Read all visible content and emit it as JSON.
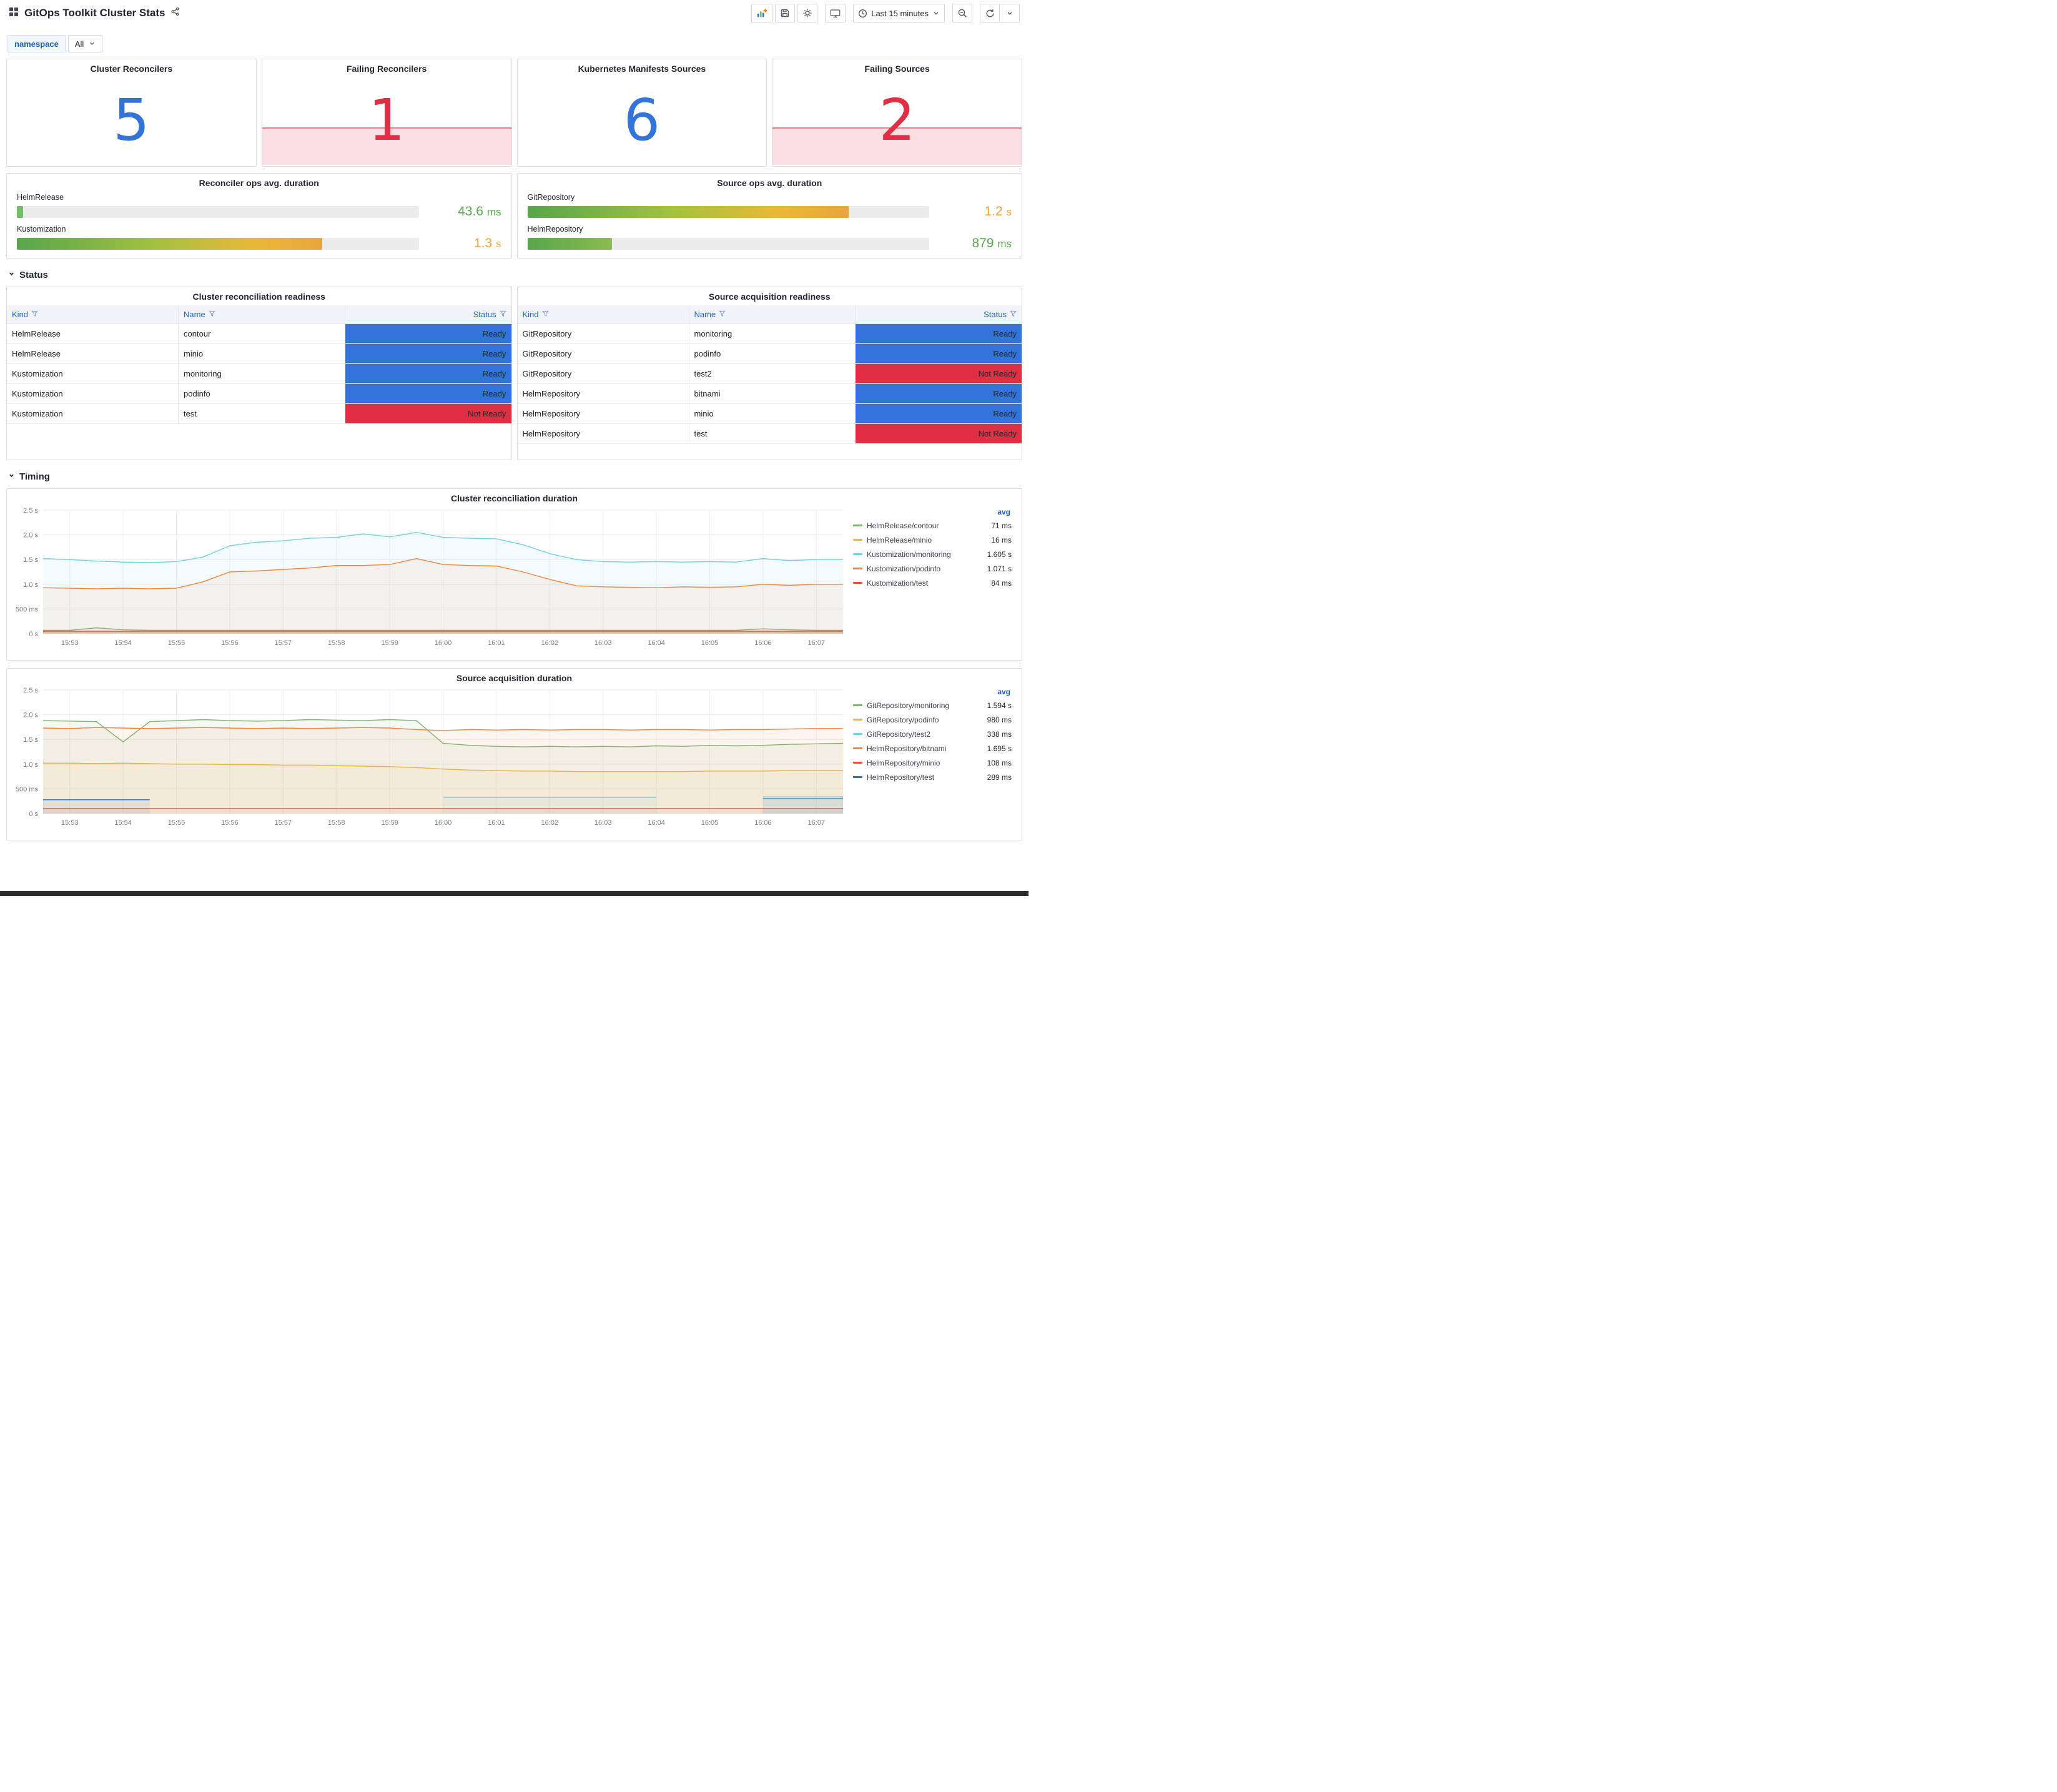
{
  "header": {
    "title": "GitOps Toolkit Cluster Stats",
    "time_range": "Last 15 minutes"
  },
  "colors": {
    "accent_blue": "#3274D9",
    "alert_red": "#E02F44",
    "ok_green": "#56A64B",
    "warn_yellow": "#F0A23A"
  },
  "icons": {
    "dashboard_grid": "four-squares",
    "share": "share-nodes",
    "add_panel": "bar-chart-plus",
    "save": "floppy-disk",
    "settings": "gear",
    "tv": "monitor",
    "clock": "clock",
    "caret": "chevron-down",
    "zoom_out": "magnifier-minus",
    "refresh": "circular-arrow",
    "filter": "funnel",
    "section_chevron": "chevron-down"
  },
  "filters": {
    "namespace_label": "namespace",
    "namespace_value": "All"
  },
  "stats": [
    {
      "title": "Cluster Reconcilers",
      "value": "5",
      "state": "ok"
    },
    {
      "title": "Failing Reconcilers",
      "value": "1",
      "state": "alert"
    },
    {
      "title": "Kubernetes Manifests Sources",
      "value": "6",
      "state": "ok"
    },
    {
      "title": "Failing Sources",
      "value": "2",
      "state": "alert"
    }
  ],
  "gauges": [
    {
      "title": "Reconciler ops avg. duration",
      "rows": [
        {
          "label": "HelmRelease",
          "value": "43.6",
          "unit": "ms",
          "percent": "1.5%",
          "bar": "green",
          "value_color": "green"
        },
        {
          "label": "Kustomization",
          "value": "1.3",
          "unit": "s",
          "percent": "76%",
          "bar": "grad",
          "value_color": "yellow"
        }
      ]
    },
    {
      "title": "Source ops avg. duration",
      "rows": [
        {
          "label": "GitRepository",
          "value": "1.2",
          "unit": "s",
          "percent": "80%",
          "bar": "grad",
          "value_color": "yellow"
        },
        {
          "label": "HelmRepository",
          "value": "879",
          "unit": "ms",
          "percent": "21%",
          "bar": "grad-short",
          "value_color": "green"
        }
      ]
    }
  ],
  "sections": {
    "status": "Status",
    "timing": "Timing"
  },
  "tables": [
    {
      "title": "Cluster reconciliation readiness",
      "columns": [
        "Kind",
        "Name",
        "Status"
      ],
      "rows": [
        {
          "kind": "HelmRelease",
          "name": "contour",
          "status": "Ready"
        },
        {
          "kind": "HelmRelease",
          "name": "minio",
          "status": "Ready"
        },
        {
          "kind": "Kustomization",
          "name": "monitoring",
          "status": "Ready"
        },
        {
          "kind": "Kustomization",
          "name": "podinfo",
          "status": "Ready"
        },
        {
          "kind": "Kustomization",
          "name": "test",
          "status": "Not Ready"
        }
      ]
    },
    {
      "title": "Source acquisition readiness",
      "columns": [
        "Kind",
        "Name",
        "Status"
      ],
      "rows": [
        {
          "kind": "GitRepository",
          "name": "monitoring",
          "status": "Ready"
        },
        {
          "kind": "GitRepository",
          "name": "podinfo",
          "status": "Ready"
        },
        {
          "kind": "GitRepository",
          "name": "test2",
          "status": "Not Ready"
        },
        {
          "kind": "HelmRepository",
          "name": "bitnami",
          "status": "Ready"
        },
        {
          "kind": "HelmRepository",
          "name": "minio",
          "status": "Ready"
        },
        {
          "kind": "HelmRepository",
          "name": "test",
          "status": "Not Ready"
        }
      ]
    }
  ],
  "chart_data": [
    {
      "type": "line",
      "title": "Cluster reconciliation duration",
      "unit": "s",
      "ylim": [
        0,
        2.5
      ],
      "yticks": [
        0,
        0.5,
        1.0,
        1.5,
        2.0,
        2.5
      ],
      "ytick_labels": [
        "0 s",
        "500 ms",
        "1.0 s",
        "1.5 s",
        "2.0 s",
        "2.5 s"
      ],
      "xtick_labels": [
        "15:53",
        "15:54",
        "15:55",
        "15:56",
        "15:57",
        "15:58",
        "15:59",
        "16:00",
        "16:01",
        "16:02",
        "16:03",
        "16:04",
        "16:05",
        "16:06",
        "16:07"
      ],
      "xtick_indices": [
        1,
        3,
        5,
        7,
        9,
        11,
        13,
        15,
        17,
        19,
        21,
        23,
        25,
        27,
        29
      ],
      "legend_header": "avg",
      "legend_position": "right",
      "grid": true,
      "series": [
        {
          "name": "HelmRelease/contour",
          "color": "#7EB26D",
          "avg": "71 ms",
          "values": [
            0.07,
            0.07,
            0.12,
            0.08,
            0.07,
            0.07,
            0.07,
            0.07,
            0.07,
            0.07,
            0.07,
            0.07,
            0.07,
            0.07,
            0.07,
            0.07,
            0.07,
            0.07,
            0.07,
            0.07,
            0.07,
            0.07,
            0.07,
            0.07,
            0.07,
            0.07,
            0.07,
            0.1,
            0.08,
            0.07,
            0.07
          ]
        },
        {
          "name": "HelmRelease/minio",
          "color": "#EAB839",
          "avg": "16 ms",
          "values": [
            0.02,
            0.02,
            0.02,
            0.02,
            0.02,
            0.02,
            0.02,
            0.02,
            0.02,
            0.02,
            0.02,
            0.02,
            0.02,
            0.02,
            0.02,
            0.02,
            0.02,
            0.02,
            0.02,
            0.02,
            0.02,
            0.02,
            0.02,
            0.02,
            0.02,
            0.02,
            0.02,
            0.02,
            0.02,
            0.02,
            0.02
          ]
        },
        {
          "name": "Kustomization/monitoring",
          "color": "#6ED0E0",
          "avg": "1.605 s",
          "values": [
            1.52,
            1.5,
            1.47,
            1.45,
            1.44,
            1.46,
            1.55,
            1.78,
            1.85,
            1.88,
            1.93,
            1.95,
            2.02,
            1.96,
            2.05,
            1.95,
            1.93,
            1.92,
            1.8,
            1.62,
            1.5,
            1.46,
            1.45,
            1.46,
            1.45,
            1.46,
            1.45,
            1.52,
            1.48,
            1.5,
            1.5
          ]
        },
        {
          "name": "Kustomization/podinfo",
          "color": "#EF843C",
          "avg": "1.071 s",
          "values": [
            0.93,
            0.92,
            0.91,
            0.92,
            0.91,
            0.92,
            1.05,
            1.25,
            1.27,
            1.3,
            1.33,
            1.38,
            1.38,
            1.4,
            1.52,
            1.4,
            1.38,
            1.37,
            1.25,
            1.1,
            0.97,
            0.95,
            0.94,
            0.93,
            0.95,
            0.94,
            0.95,
            1.0,
            0.98,
            1.0,
            1.0
          ]
        },
        {
          "name": "Kustomization/test",
          "color": "#E24D42",
          "avg": "84 ms",
          "values": [
            0.05,
            0.05,
            0.05,
            0.05,
            0.05,
            0.05,
            0.05,
            0.05,
            0.05,
            0.05,
            0.05,
            0.05,
            0.05,
            0.05,
            0.05,
            0.05,
            0.05,
            0.05,
            0.05,
            0.05,
            0.05,
            0.05,
            0.05,
            0.05,
            0.05,
            0.05,
            0.05,
            0.05,
            0.05,
            0.05,
            0.05
          ]
        }
      ]
    },
    {
      "type": "line",
      "title": "Source acquisition duration",
      "unit": "s",
      "ylim": [
        0,
        2.5
      ],
      "yticks": [
        0,
        0.5,
        1.0,
        1.5,
        2.0,
        2.5
      ],
      "ytick_labels": [
        "0 s",
        "500 ms",
        "1.0 s",
        "1.5 s",
        "2.0 s",
        "2.5 s"
      ],
      "xtick_labels": [
        "15:53",
        "15:54",
        "15:55",
        "15:56",
        "15:57",
        "15:58",
        "15:59",
        "16:00",
        "16:01",
        "16:02",
        "16:03",
        "16:04",
        "16:05",
        "16:06",
        "16:07"
      ],
      "xtick_indices": [
        1,
        3,
        5,
        7,
        9,
        11,
        13,
        15,
        17,
        19,
        21,
        23,
        25,
        27,
        29
      ],
      "legend_header": "avg",
      "legend_position": "right",
      "grid": true,
      "series": [
        {
          "name": "GitRepository/monitoring",
          "color": "#7EB26D",
          "avg": "1.594 s",
          "values": [
            1.88,
            1.87,
            1.86,
            1.45,
            1.86,
            1.88,
            1.9,
            1.88,
            1.87,
            1.88,
            1.9,
            1.89,
            1.88,
            1.9,
            1.88,
            1.42,
            1.38,
            1.36,
            1.35,
            1.36,
            1.35,
            1.36,
            1.35,
            1.37,
            1.36,
            1.38,
            1.37,
            1.38,
            1.4,
            1.41,
            1.42
          ]
        },
        {
          "name": "GitRepository/podinfo",
          "color": "#EAB839",
          "avg": "980 ms",
          "values": [
            1.02,
            1.02,
            1.01,
            1.02,
            1.01,
            1.0,
            1.0,
            0.99,
            0.99,
            0.98,
            0.98,
            0.97,
            0.96,
            0.95,
            0.93,
            0.9,
            0.88,
            0.87,
            0.86,
            0.86,
            0.85,
            0.85,
            0.85,
            0.85,
            0.85,
            0.86,
            0.86,
            0.86,
            0.87,
            0.87,
            0.87
          ]
        },
        {
          "name": "GitRepository/test2",
          "color": "#6ED0E0",
          "avg": "338 ms",
          "values": [
            null,
            null,
            null,
            null,
            null,
            null,
            null,
            null,
            null,
            null,
            null,
            null,
            null,
            null,
            null,
            0.33,
            0.33,
            0.33,
            0.33,
            0.33,
            0.33,
            0.33,
            0.33,
            0.33,
            null,
            null,
            null,
            0.34,
            0.34,
            0.34,
            0.34
          ]
        },
        {
          "name": "HelmRepository/bitnami",
          "color": "#EF843C",
          "avg": "1.695 s",
          "values": [
            1.73,
            1.72,
            1.74,
            1.73,
            1.72,
            1.73,
            1.74,
            1.73,
            1.72,
            1.73,
            1.72,
            1.73,
            1.74,
            1.73,
            1.7,
            1.68,
            1.7,
            1.69,
            1.7,
            1.69,
            1.7,
            1.7,
            1.69,
            1.7,
            1.7,
            1.69,
            1.7,
            1.7,
            1.71,
            1.72,
            1.72
          ]
        },
        {
          "name": "HelmRepository/minio",
          "color": "#E24D42",
          "avg": "108 ms",
          "values": [
            0.1,
            0.1,
            0.1,
            0.1,
            0.1,
            0.1,
            0.1,
            0.1,
            0.1,
            0.1,
            0.1,
            0.1,
            0.1,
            0.1,
            0.1,
            0.1,
            0.1,
            0.1,
            0.1,
            0.1,
            0.1,
            0.1,
            0.1,
            0.1,
            0.1,
            0.1,
            0.1,
            0.1,
            0.1,
            0.1,
            0.1
          ]
        },
        {
          "name": "HelmRepository/test",
          "color": "#1F78C1",
          "avg": "289 ms",
          "values": [
            0.28,
            0.28,
            0.28,
            0.28,
            0.28,
            null,
            null,
            null,
            null,
            null,
            null,
            null,
            null,
            null,
            null,
            null,
            null,
            null,
            null,
            null,
            null,
            null,
            null,
            null,
            null,
            null,
            null,
            0.3,
            0.3,
            0.3,
            0.3
          ]
        }
      ]
    }
  ]
}
